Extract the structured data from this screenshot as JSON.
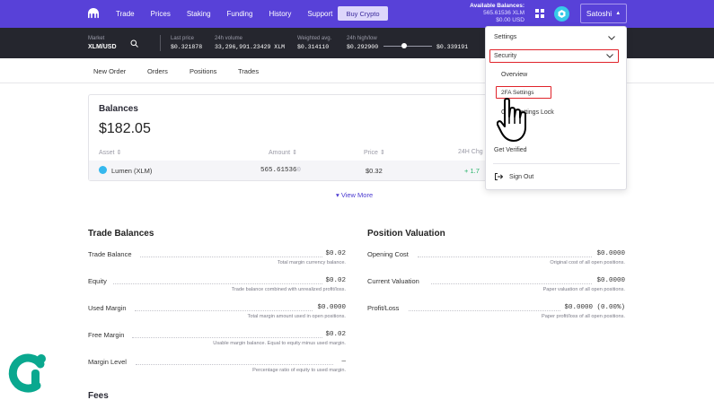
{
  "nav": {
    "links": [
      "Trade",
      "Prices",
      "Staking",
      "Funding",
      "History",
      "Support"
    ],
    "buy_crypto": "Buy Crypto",
    "available_title": "Available Balances:",
    "available_xlm": "565.61536 XLM",
    "available_usd": "$0.00 USD",
    "username": "Satoshi",
    "user_caret": "▲"
  },
  "ticker": {
    "market_label": "Market",
    "market_value": "XLM/USD",
    "last_price_label": "Last price",
    "last_price": "$0.321878",
    "volume_label": "24h volume",
    "volume": "33,296,991.23429 XLM",
    "weighted_label": "Weighted avg.",
    "weighted": "$0.314110",
    "highlow_label": "24h high/low",
    "low": "$0.292900",
    "high": "$0.339191"
  },
  "subtabs": [
    "New Order",
    "Orders",
    "Positions",
    "Trades"
  ],
  "balances": {
    "title": "Balances",
    "total": "$182.05",
    "columns": {
      "asset": "Asset ⇕",
      "amount": "Amount ⇕",
      "price": "Price ⇕",
      "change": "24H Chg"
    },
    "row": {
      "asset": "Lumen (XLM)",
      "amount": "565.61536",
      "amount_faded": "0",
      "price": "$0.32",
      "change": "+ 1.7"
    },
    "view_more": "▾ View More"
  },
  "trade_balances": {
    "title": "Trade Balances",
    "rows": [
      {
        "label": "Trade Balance",
        "value": "$0.02",
        "desc": "Total margin currency balance."
      },
      {
        "label": "Equity",
        "value": "$0.02",
        "desc": "Trade balance combined with unrealized profit/loss."
      },
      {
        "label": "Used Margin",
        "value": "$0.0000",
        "desc": "Total margin amount used in open positions."
      },
      {
        "label": "Free Margin",
        "value": "$0.02",
        "desc": "Usable margin balance. Equal to equity minus used margin."
      },
      {
        "label": "Margin Level",
        "value": "—",
        "desc": "Percentage ratio of equity to used margin."
      }
    ]
  },
  "position_valuation": {
    "title": "Position Valuation",
    "rows": [
      {
        "label": "Opening Cost",
        "value": "$0.0000",
        "desc": "Original cost of all open positions."
      },
      {
        "label": "Current Valuation",
        "value": "$0.0000",
        "desc": "Paper valuation of all open positions."
      },
      {
        "label": "Profit/Loss",
        "value": "$0.0000  (0.00%)",
        "desc": "Paper profit/loss of all open positions."
      }
    ]
  },
  "fees_title": "Fees",
  "menu": {
    "settings": "Settings",
    "security": "Security",
    "overview": "Overview",
    "twofa": "2FA Settings",
    "global_lock_visible": "G",
    "global_lock_rest": "ettings Lock",
    "partial_item": "A",
    "get_verified": "Get Verified",
    "sign_out": "Sign Out"
  },
  "colors": {
    "brand_purple": "#5841d8",
    "ticker_bg": "#25262e",
    "highlight_red": "#e0232a",
    "positive": "#29b36b"
  }
}
